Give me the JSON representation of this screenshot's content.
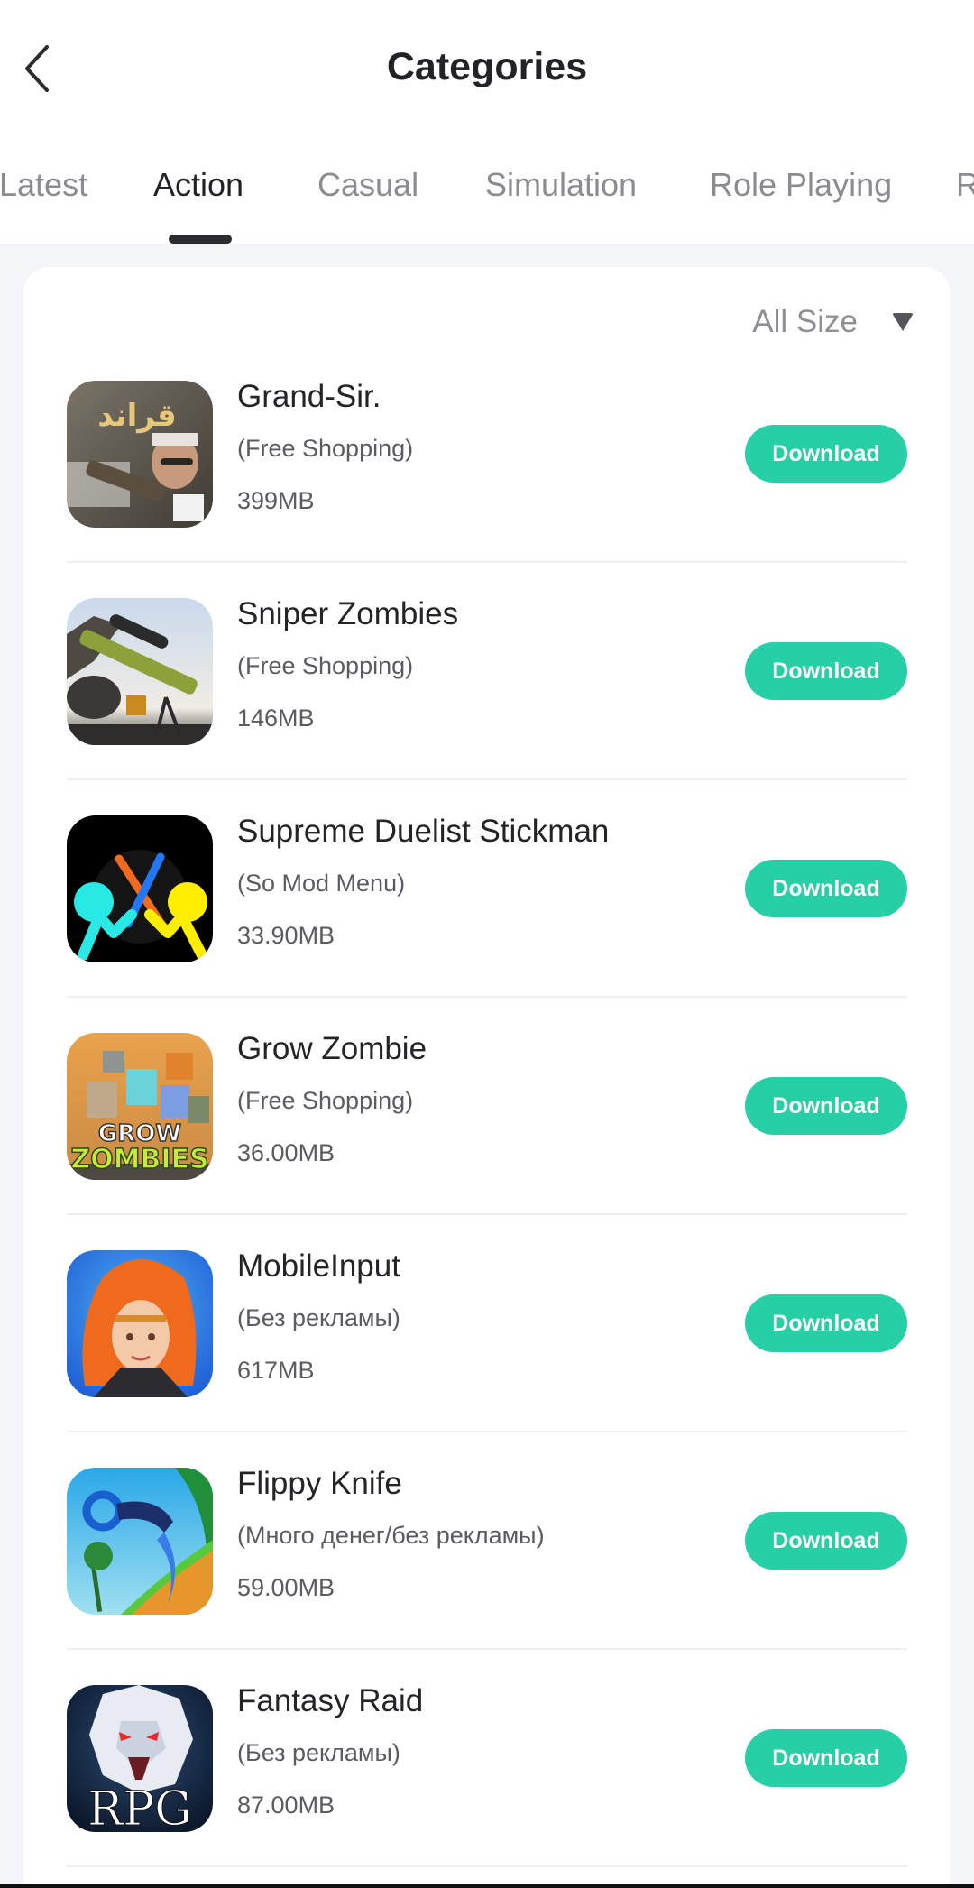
{
  "header": {
    "title": "Categories",
    "back_icon": "chevron-left-icon"
  },
  "tabs": [
    {
      "label": "Latest",
      "active": false
    },
    {
      "label": "Action",
      "active": true
    },
    {
      "label": "Casual",
      "active": false
    },
    {
      "label": "Simulation",
      "active": false
    },
    {
      "label": "Role Playing",
      "active": false
    },
    {
      "label": "R",
      "active": false
    }
  ],
  "filter": {
    "label": "All Size",
    "icon": "triangle-down-icon"
  },
  "apps": [
    {
      "name": "Grand-Sir.",
      "tag": "(Free Shopping)",
      "size": "399MB",
      "button": "Download",
      "icon": "grand-sir-app-icon"
    },
    {
      "name": "Sniper Zombies",
      "tag": "(Free Shopping)",
      "size": "146MB",
      "button": "Download",
      "icon": "sniper-zombies-app-icon"
    },
    {
      "name": "Supreme Duelist Stickman",
      "tag": "(So Mod Menu)",
      "size": "33.90MB",
      "button": "Download",
      "icon": "stickman-app-icon"
    },
    {
      "name": "Grow Zombie",
      "tag": "(Free Shopping)",
      "size": "36.00MB",
      "button": "Download",
      "icon": "grow-zombie-app-icon"
    },
    {
      "name": "MobileInput",
      "tag": "(Без рекламы)",
      "size": "617MB",
      "button": "Download",
      "icon": "mobileinput-app-icon"
    },
    {
      "name": "Flippy Knife",
      "tag": "(Много денег/без рекламы)",
      "size": "59.00MB",
      "button": "Download",
      "icon": "flippy-knife-app-icon"
    },
    {
      "name": "Fantasy Raid",
      "tag": "(Без рекламы)",
      "size": "87.00MB",
      "button": "Download",
      "icon": "fantasy-raid-app-icon"
    }
  ],
  "colors": {
    "accent": "#26cfa5",
    "background": "#f4f5f8",
    "active_tab": "#222326",
    "inactive_tab": "#8b8c91"
  },
  "icon_art": {
    "grand_sir_text": "قراند",
    "grow_zombie_line1": "GROW",
    "grow_zombie_line2": "ZOMBIES",
    "fantasy_raid_text": "RPG"
  }
}
